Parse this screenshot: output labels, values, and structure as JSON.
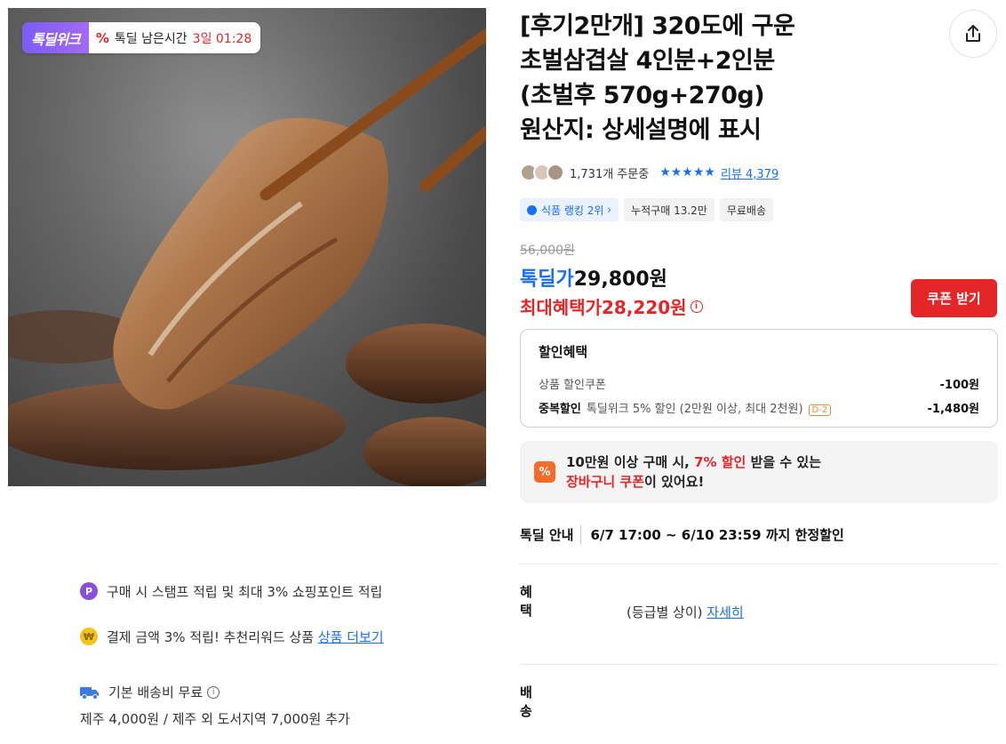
{
  "deal_tag": {
    "brand": "톡딜위크",
    "label": "톡딜 남은시간",
    "remaining": "3일 01:28"
  },
  "product": {
    "title_lines": [
      "[후기2만개] 320도에 구운",
      "초벌삼겹살 4인분+2인분",
      "(초벌후 570g+270g)",
      "원산지: 상세설명에 표시"
    ],
    "orders": "1,731개 주문중",
    "stars": "★★★★★",
    "review_label": "리뷰 4,379"
  },
  "badges": {
    "rank": "식품 랭킹 2위",
    "cumulative": "누적구매 13.2만",
    "shipping": "무료배송"
  },
  "price": {
    "original": "56,000원",
    "deal_label": "톡딜가",
    "deal_value": "29,800원",
    "max_label": "최대혜택가",
    "max_value": "28,220원",
    "coupon_button": "쿠폰 받기"
  },
  "discount": {
    "header": "할인혜택",
    "rows": [
      {
        "label": "상품 할인쿠폰",
        "amount": "-100원"
      },
      {
        "bold": "중복할인",
        "label": "톡딜위크 5% 할인 (2만원 이상, 최대 2천원)",
        "tag": "D-2",
        "amount": "-1,480원"
      }
    ]
  },
  "cart_coupon": {
    "icon": "%",
    "line1_a": "10만원 이상 구매 시, ",
    "line1_red": "7% 할인",
    "line1_b": " 받을 수 있는",
    "line2_red": "장바구니 쿠폰",
    "line2_b": "이 있어요!"
  },
  "guide": {
    "key": "톡딜 안내",
    "value": "6/7 17:00 ~ 6/10 23:59 까지 한정할인"
  },
  "benefit": {
    "key": "혜택",
    "line1": "구매 시 스탬프 적립 및 최대 3% 쇼핑포인트 적립",
    "line2": "(등급별 상이)",
    "line2_link": "자세히",
    "line3": "결제 금액 3% 적립! 추천리워드 상품",
    "line3_link": "상품 더보기"
  },
  "shipping": {
    "key": "배송",
    "line1": "기본 배송비 무료",
    "line2": "제주 4,000원 / 제주 외 도서지역 7,000원 추가"
  }
}
